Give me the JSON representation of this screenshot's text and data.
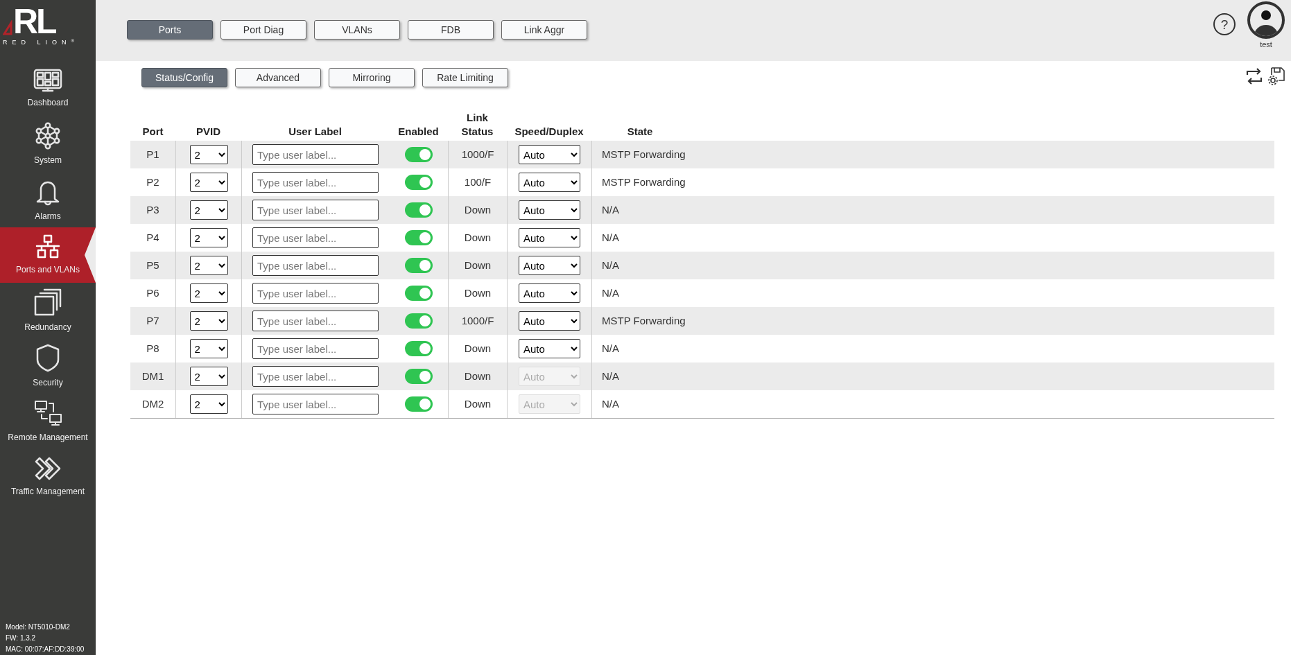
{
  "logo": {
    "letters": "RL",
    "wordmark": "RED LION",
    "mark": "®"
  },
  "sidebar": {
    "items": [
      {
        "label": "Dashboard",
        "kind": "dashboard",
        "selected": false
      },
      {
        "label": "System",
        "kind": "system",
        "selected": false
      },
      {
        "label": "Alarms",
        "kind": "alarms",
        "selected": false
      },
      {
        "label": "Ports and VLANs",
        "kind": "ports",
        "selected": true
      },
      {
        "label": "Redundancy",
        "kind": "redundancy",
        "selected": false
      },
      {
        "label": "Security",
        "kind": "security",
        "selected": false
      },
      {
        "label": "Remote Management",
        "kind": "remote",
        "selected": false
      },
      {
        "label": "Traffic Management",
        "kind": "traffic",
        "selected": false
      }
    ],
    "device_info": [
      "Model: NT5010-DM2",
      "FW: 1.3.2",
      "MAC: 00:07:AF:DD:39:00"
    ]
  },
  "tabs": [
    {
      "label": "Ports",
      "selected": true
    },
    {
      "label": "Port Diag",
      "selected": false
    },
    {
      "label": "VLANs",
      "selected": false
    },
    {
      "label": "FDB",
      "selected": false
    },
    {
      "label": "Link Aggr",
      "selected": false
    }
  ],
  "user": {
    "help": "?",
    "name": "test"
  },
  "subtabs": [
    {
      "label": "Status/Config",
      "selected": true
    },
    {
      "label": "Advanced",
      "selected": false
    },
    {
      "label": "Mirroring",
      "selected": false
    },
    {
      "label": "Rate Limiting",
      "selected": false
    }
  ],
  "table": {
    "columns": [
      "Port",
      "PVID",
      "User Label",
      "Enabled",
      [
        "Link",
        "Status"
      ],
      "Speed/Duplex",
      "State"
    ],
    "rows": [
      {
        "port": "P1",
        "pvid": "2",
        "label_placeholder": "Type user label...",
        "enabled": true,
        "link_status": "1000/F",
        "speed": "Auto",
        "speed_disabled": false,
        "state": "MSTP Forwarding"
      },
      {
        "port": "P2",
        "pvid": "2",
        "label_placeholder": "Type user label...",
        "enabled": true,
        "link_status": "100/F",
        "speed": "Auto",
        "speed_disabled": false,
        "state": "MSTP Forwarding"
      },
      {
        "port": "P3",
        "pvid": "2",
        "label_placeholder": "Type user label...",
        "enabled": true,
        "link_status": "Down",
        "speed": "Auto",
        "speed_disabled": false,
        "state": "N/A"
      },
      {
        "port": "P4",
        "pvid": "2",
        "label_placeholder": "Type user label...",
        "enabled": true,
        "link_status": "Down",
        "speed": "Auto",
        "speed_disabled": false,
        "state": "N/A"
      },
      {
        "port": "P5",
        "pvid": "2",
        "label_placeholder": "Type user label...",
        "enabled": true,
        "link_status": "Down",
        "speed": "Auto",
        "speed_disabled": false,
        "state": "N/A"
      },
      {
        "port": "P6",
        "pvid": "2",
        "label_placeholder": "Type user label...",
        "enabled": true,
        "link_status": "Down",
        "speed": "Auto",
        "speed_disabled": false,
        "state": "N/A"
      },
      {
        "port": "P7",
        "pvid": "2",
        "label_placeholder": "Type user label...",
        "enabled": true,
        "link_status": "1000/F",
        "speed": "Auto",
        "speed_disabled": false,
        "state": "MSTP Forwarding"
      },
      {
        "port": "P8",
        "pvid": "2",
        "label_placeholder": "Type user label...",
        "enabled": true,
        "link_status": "Down",
        "speed": "Auto",
        "speed_disabled": false,
        "state": "N/A"
      },
      {
        "port": "DM1",
        "pvid": "2",
        "label_placeholder": "Type user label...",
        "enabled": true,
        "link_status": "Down",
        "speed": "Auto",
        "speed_disabled": true,
        "state": "N/A"
      },
      {
        "port": "DM2",
        "pvid": "2",
        "label_placeholder": "Type user label...",
        "enabled": true,
        "link_status": "Down",
        "speed": "Auto",
        "speed_disabled": true,
        "state": "N/A"
      }
    ]
  }
}
